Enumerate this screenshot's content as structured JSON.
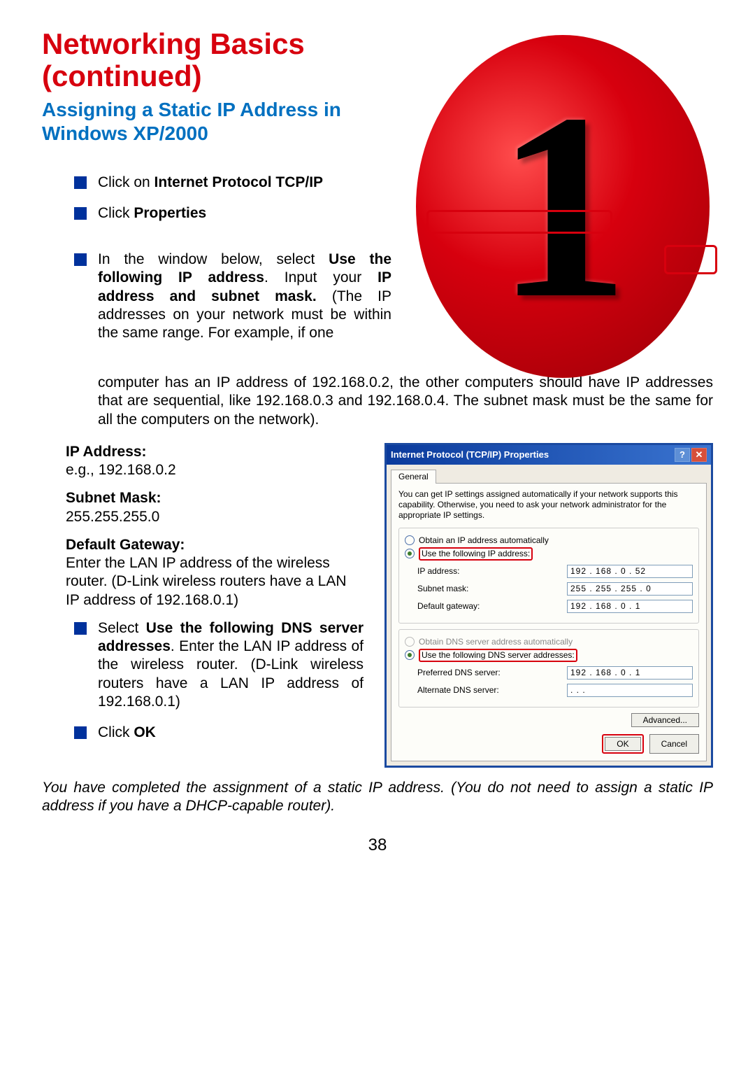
{
  "heading": "Networking Basics (continued)",
  "subheading": "Assigning a Static IP Address in Windows XP/2000",
  "bullets_a": {
    "b1_pre": "Click on ",
    "b1_bold": "Internet Protocol TCP/IP",
    "b2_pre": "Click ",
    "b2_bold": "Properties",
    "b3_pre": "In the window below, select ",
    "b3_bold1": "Use the following IP address",
    "b3_mid": ". Input your ",
    "b3_bold2": "IP address and subnet mask.",
    "b3_post": " (The IP addresses on your network must be within the same range. For example, if one"
  },
  "para_continue": "computer has an IP address of 192.168.0.2, the other computers should have IP addresses that are sequential, like 192.168.0.3 and 192.168.0.4. The subnet mask must be the same for all the computers on the network).",
  "fields": {
    "ip_label": "IP Address:",
    "ip_value": "e.g., 192.168.0.2",
    "subnet_label": "Subnet Mask:",
    "subnet_value": "255.255.255.0",
    "gateway_label": "Default Gateway:",
    "gateway_value": "Enter the LAN IP address of the wireless router. (D-Link wireless routers have a LAN IP address of 192.168.0.1)"
  },
  "bullets_b": {
    "b1_pre": "Select ",
    "b1_bold": "Use the following DNS server addresses",
    "b1_post": ". Enter the LAN IP address of the wireless router. (D-Link wireless routers have a LAN IP address of 192.168.0.1)",
    "b2_pre": "Click ",
    "b2_bold": "OK"
  },
  "italic_note": "You have completed the assignment of a static IP address. (You do not need to assign a static IP address if you have a DHCP-capable router).",
  "page_num": "38",
  "figure_number": "1",
  "dialog": {
    "title": "Internet Protocol (TCP/IP) Properties",
    "tab": "General",
    "descr": "You can get IP settings assigned automatically if your network supports this capability. Otherwise, you need to ask your network administrator for the appropriate IP settings.",
    "radio1": "Obtain an IP address automatically",
    "radio2": "Use the following IP address:",
    "f_ip_label": "IP address:",
    "f_ip_val": "192 . 168 .   0  . 52",
    "f_sub_label": "Subnet mask:",
    "f_sub_val": "255 . 255 . 255 .  0",
    "f_gw_label": "Default gateway:",
    "f_gw_val": "192 . 168 .   0  .  1",
    "radio3": "Obtain DNS server address automatically",
    "radio4": "Use the following DNS server addresses:",
    "f_pdns_label": "Preferred DNS server:",
    "f_pdns_val": "192 . 168 .   0  .  1",
    "f_adns_label": "Alternate DNS server:",
    "f_adns_val": " .       .       .   ",
    "advanced": "Advanced...",
    "ok": "OK",
    "cancel": "Cancel"
  }
}
